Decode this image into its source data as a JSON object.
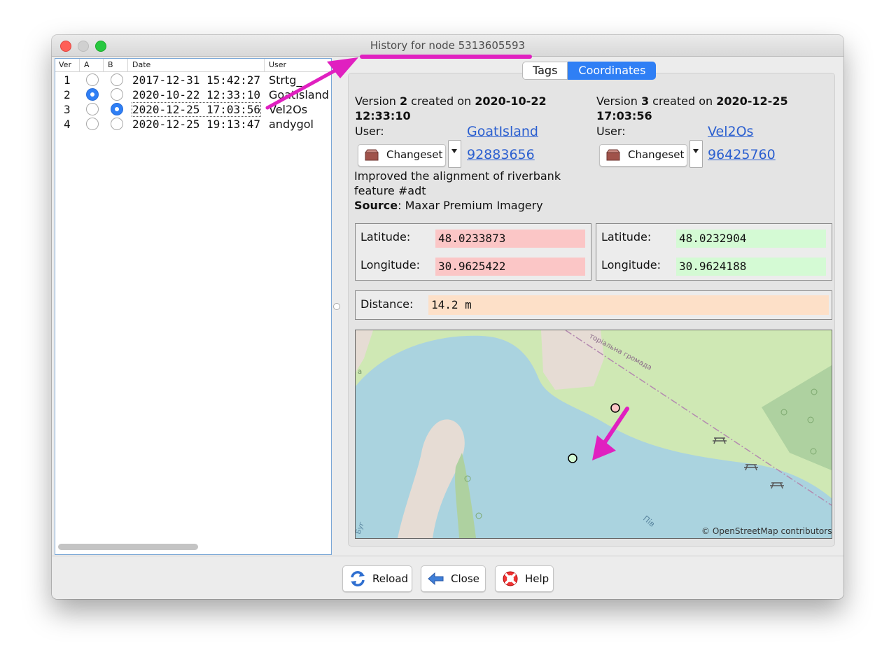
{
  "window": {
    "title": "History for node 5313605593"
  },
  "table": {
    "headers": {
      "ver": "Ver",
      "a": "A",
      "b": "B",
      "date": "Date",
      "user": "User"
    },
    "rows": [
      {
        "ver": "1",
        "a_selected": false,
        "b_selected": false,
        "date": "2017-12-31 15:42:27",
        "user": "Strtg_"
      },
      {
        "ver": "2",
        "a_selected": true,
        "b_selected": false,
        "date": "2020-10-22 12:33:10",
        "user": "GoatIsland"
      },
      {
        "ver": "3",
        "a_selected": false,
        "b_selected": true,
        "date": "2020-12-25 17:03:56",
        "user": "Vel2Os"
      },
      {
        "ver": "4",
        "a_selected": false,
        "b_selected": false,
        "date": "2020-12-25 19:13:47",
        "user": "andygol"
      }
    ]
  },
  "tabs": [
    {
      "label": "Tags",
      "active": false
    },
    {
      "label": "Coordinates",
      "active": true
    }
  ],
  "left_version": {
    "prefix": "Version",
    "num": "2",
    "created_on": "created on",
    "date": "2020-10-22",
    "time": "12:33:10",
    "user_label": "User:",
    "user": "GoatIsland",
    "changeset_label": "Changeset",
    "changeset_id": "92883656",
    "comment": "Improved the alignment of riverbank feature #adt",
    "source_label": "Source",
    "source": "Maxar Premium Imagery",
    "lat_label": "Latitude:",
    "lat": "48.0233873",
    "lon_label": "Longitude:",
    "lon": "30.9625422"
  },
  "right_version": {
    "prefix": "Version",
    "num": "3",
    "created_on": "created on",
    "date": "2020-12-25",
    "time": "17:03:56",
    "user_label": "User:",
    "user": "Vel2Os",
    "changeset_label": "Changeset",
    "changeset_id": "96425760",
    "lat_label": "Latitude:",
    "lat": "48.0232904",
    "lon_label": "Longitude:",
    "lon": "30.9624188"
  },
  "distance": {
    "label": "Distance:",
    "value": "14.2 m"
  },
  "map": {
    "attribution": "© OpenStreetMap contributors",
    "label_boundary": "торіальна громада",
    "label_river_1": "Буг",
    "label_river_2": "Пів",
    "label_edge": "а"
  },
  "buttons": {
    "reload": "Reload",
    "close": "Close",
    "help": "Help"
  },
  "colors": {
    "accent": "#2f7ff5",
    "old_value": "#fbc6c6",
    "new_value": "#d4fad4",
    "distance": "#fde0c8",
    "annotation": "#e020c0"
  }
}
